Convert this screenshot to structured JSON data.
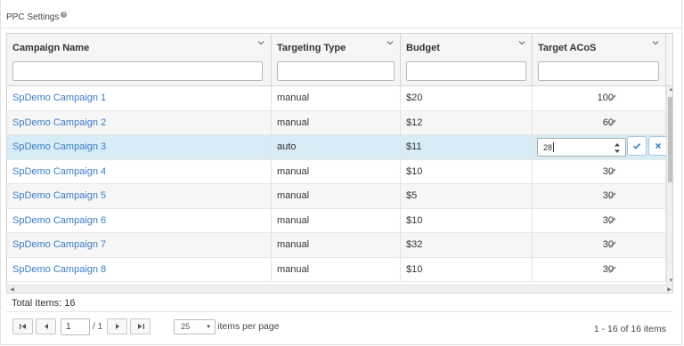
{
  "panel": {
    "title": "PPC Settings",
    "info_icon": "i"
  },
  "columns": [
    {
      "label": "Campaign Name",
      "filter_value": ""
    },
    {
      "label": "Targeting Type",
      "filter_value": ""
    },
    {
      "label": "Budget",
      "filter_value": ""
    },
    {
      "label": "Target ACoS",
      "filter_value": ""
    }
  ],
  "rows": [
    {
      "campaign": "SpDemo Campaign 1",
      "type": "manual",
      "budget": "$20",
      "acos": "100"
    },
    {
      "campaign": "SpDemo Campaign 2",
      "type": "manual",
      "budget": "$12",
      "acos": "60"
    },
    {
      "campaign": "SpDemo Campaign 3",
      "type": "auto",
      "budget": "$11",
      "acos": "28"
    },
    {
      "campaign": "SpDemo Campaign 4",
      "type": "manual",
      "budget": "$10",
      "acos": "30"
    },
    {
      "campaign": "SpDemo Campaign 5",
      "type": "manual",
      "budget": "$5",
      "acos": "30"
    },
    {
      "campaign": "SpDemo Campaign 6",
      "type": "manual",
      "budget": "$10",
      "acos": "30"
    },
    {
      "campaign": "SpDemo Campaign 7",
      "type": "manual",
      "budget": "$32",
      "acos": "30"
    },
    {
      "campaign": "SpDemo Campaign 8",
      "type": "manual",
      "budget": "$10",
      "acos": "30"
    }
  ],
  "editing_row": 2,
  "editor": {
    "value": "28"
  },
  "footer": {
    "total": "Total Items: 16",
    "page": "1",
    "of_pages": "/ 1",
    "page_size": "25",
    "items_per_page": "items per page",
    "range": "1 - 16 of 16 items"
  },
  "colors": {
    "link": "#3b7cc6",
    "selected_row": "#d8ecf5",
    "accent": "#2f7dc1"
  }
}
